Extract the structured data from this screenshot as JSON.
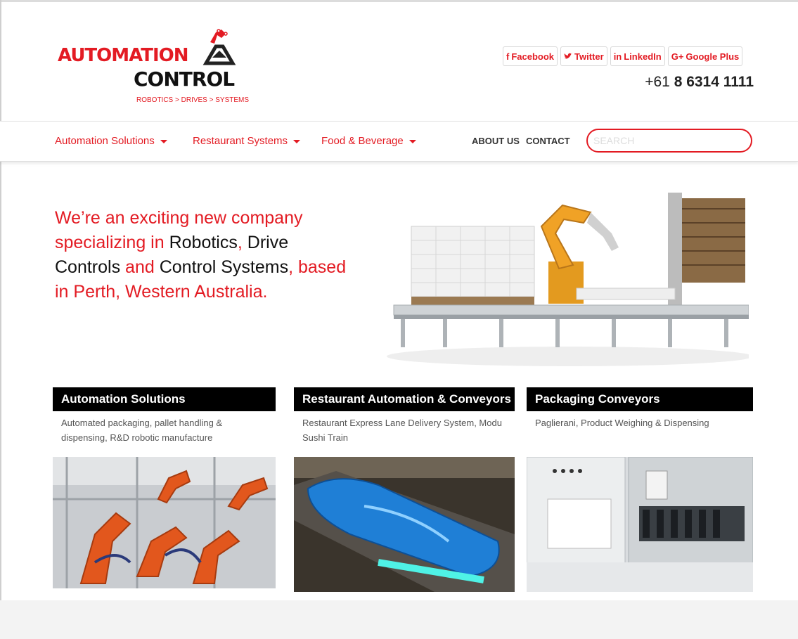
{
  "header": {
    "logo": {
      "line1": "AUTOMATION",
      "line2": "CONTROL",
      "tagline": "ROBOTICS > DRIVES > SYSTEMS"
    },
    "social": [
      {
        "icon": "facebook-icon",
        "glyph": "f",
        "label": "Facebook"
      },
      {
        "icon": "twitter-icon",
        "glyph": "🐦",
        "label": "Twitter"
      },
      {
        "icon": "linkedin-icon",
        "glyph": "in",
        "label": "LinkedIn"
      },
      {
        "icon": "google-plus-icon",
        "glyph": "G+",
        "label": "Google Plus"
      }
    ],
    "phone_prefix": "+61",
    "phone_number": "8 6314 1111"
  },
  "nav": {
    "menus": [
      "Automation Solutions",
      "Restaurant Systems",
      "Food & Beverage"
    ],
    "links": [
      "ABOUT US",
      "CONTACT"
    ],
    "search_placeholder": "SEARCH"
  },
  "hero": {
    "parts": [
      {
        "text": "We’re an exciting new company specializing in ",
        "style": "red"
      },
      {
        "text": "Robotics",
        "style": "dark"
      },
      {
        "text": ", ",
        "style": "red"
      },
      {
        "text": "Drive Controls",
        "style": "dark"
      },
      {
        "text": " and ",
        "style": "red"
      },
      {
        "text": "Control Systems",
        "style": "dark"
      },
      {
        "text": ", based in Perth, Western Australia.",
        "style": "red"
      }
    ]
  },
  "cards": [
    {
      "title": "Automation Solutions",
      "desc": "Automated packaging, pallet handling & dispensing, R&D robotic manufacture"
    },
    {
      "title": "Restaurant Automation & Conveyors",
      "desc": "Restaurant Express Lane Delivery System, Modu Sushi Train"
    },
    {
      "title": "Packaging Conveyors",
      "desc": "Paglierani, Product Weighing & Dispensing"
    }
  ],
  "colors": {
    "brand_red": "#e31b23",
    "dark": "#111111"
  }
}
